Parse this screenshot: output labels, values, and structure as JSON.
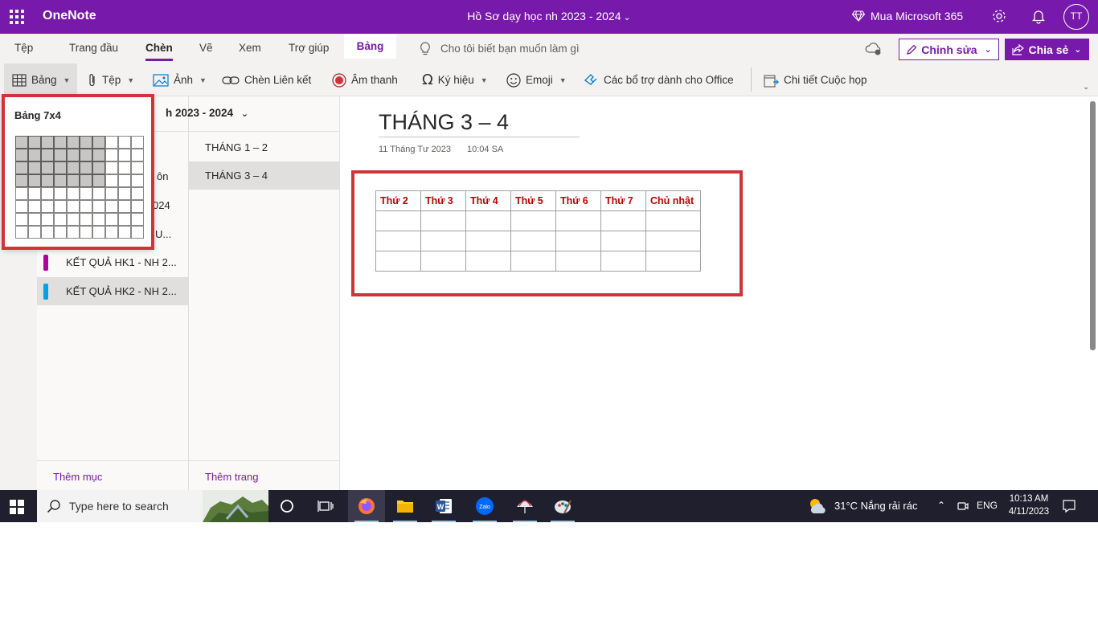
{
  "titlebar": {
    "app_name": "OneNote",
    "document_title": "Hồ Sơ dạy học nh 2023 - 2024",
    "buy_label": "Mua Microsoft 365",
    "avatar_initials": "TT",
    "bg_color": "#7719aa"
  },
  "tabs": {
    "items": [
      "Tệp",
      "Trang đầu",
      "Chèn",
      "Vẽ",
      "Xem",
      "Trợ giúp"
    ],
    "active": "Chèn",
    "contextual_tab": "Bảng",
    "tell_me": "Cho tôi biết bạn muốn làm gì",
    "edit_label": "Chỉnh sửa",
    "share_label": "Chia sẻ"
  },
  "toolbar": {
    "table": "Bảng",
    "file": "Tệp",
    "picture": "Ảnh",
    "link": "Chèn Liên kết",
    "audio": "Âm thanh",
    "symbol": "Ký hiệu",
    "emoji": "Emoji",
    "addins": "Các bổ trợ dành cho Office",
    "meeting": "Chi tiết Cuộc họp"
  },
  "table_picker": {
    "label": "Bảng 7x4",
    "columns": 10,
    "rows": 8,
    "selected_columns": 7,
    "selected_rows": 4
  },
  "navigation": {
    "notebook_title": "h 2023 - 2024",
    "sections_partial": [
      "ôn",
      "024",
      "U..."
    ],
    "sections": [
      {
        "label": "KẾT QUẢ HK1 - NH 2...",
        "color": "#b4009e"
      },
      {
        "label": "KẾT QUẢ HK2 - NH 2...",
        "color": "#00a2e8"
      }
    ],
    "pages": [
      "THÁNG 1 – 2",
      "THÁNG 3 – 4"
    ],
    "add_section": "Thêm mục",
    "add_page": "Thêm trang"
  },
  "page": {
    "title": "THÁNG 3 – 4",
    "date": "11 Tháng Tư 2023",
    "time": "10:04 SA",
    "table_headers": [
      "Thứ 2",
      "Thứ 3",
      "Thứ 4",
      "Thứ 5",
      "Thứ 6",
      "Thứ 7",
      "Chủ nhật"
    ],
    "empty_rows": 3,
    "header_color": "#c00000"
  },
  "taskbar": {
    "search_placeholder": "Type here to search",
    "weather": "31°C  Nắng rải rác",
    "language": "ENG",
    "time": "10:13 AM",
    "date": "4/11/2023"
  }
}
